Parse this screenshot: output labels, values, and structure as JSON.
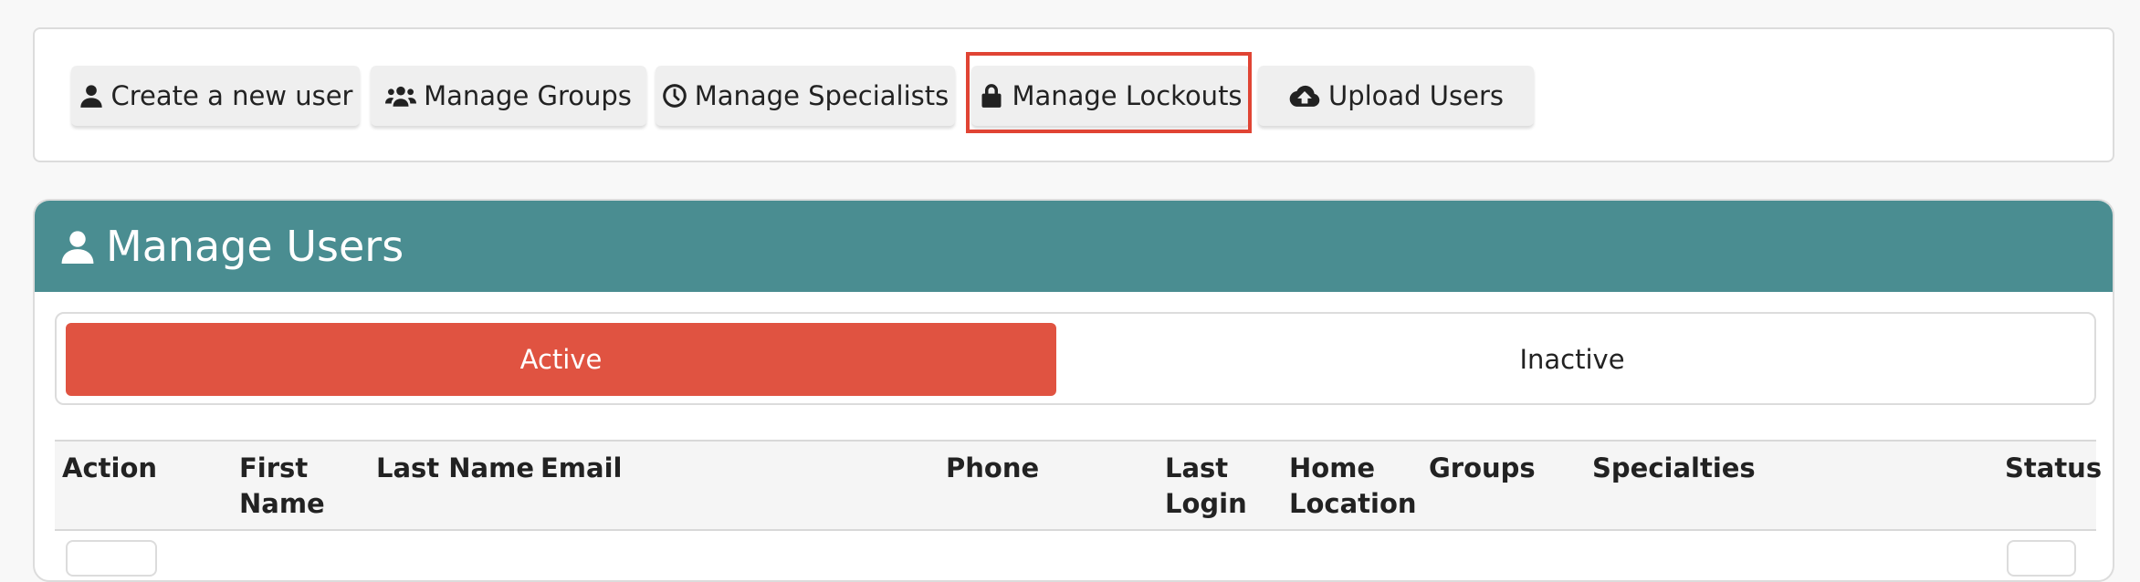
{
  "toolbar": {
    "buttons": [
      {
        "label": "Create a new user",
        "icon": "user-icon"
      },
      {
        "label": "Manage Groups",
        "icon": "users-icon"
      },
      {
        "label": "Manage Specialists",
        "icon": "clock-icon"
      },
      {
        "label": "Manage Lockouts",
        "icon": "lock-icon"
      },
      {
        "label": "Upload Users",
        "icon": "cloud-upload-icon"
      }
    ],
    "highlighted": "Manage Lockouts",
    "highlight_color": "#e04434"
  },
  "panel": {
    "title": "Manage Users",
    "icon": "user-icon",
    "header_color": "#4a8d91"
  },
  "tabs": {
    "active": "Active",
    "inactive": "Inactive",
    "active_color": "#e05341"
  },
  "table": {
    "columns": [
      "Action",
      "First Name",
      "Last Name",
      "Email",
      "Phone",
      "Last Login",
      "Home Location",
      "Groups",
      "Specialties",
      "Status"
    ]
  }
}
